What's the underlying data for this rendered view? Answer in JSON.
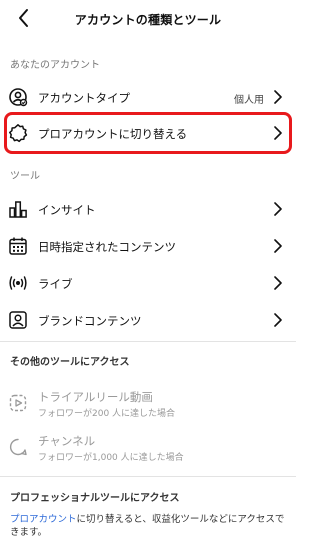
{
  "header": {
    "title": "アカウントの種類とツール",
    "back_icon": "chevron-left-icon"
  },
  "your_account": {
    "section_label": "あなたのアカウント",
    "account_type": {
      "label": "アカウントタイプ",
      "value": "個人用",
      "icon": "person-badge-icon"
    },
    "switch_pro": {
      "label": "プロアカウントに切り替える",
      "icon": "gear-badge-icon",
      "highlight_color": "#e8191c"
    }
  },
  "tools": {
    "section_label": "ツール",
    "items": [
      {
        "label": "インサイト",
        "icon": "bar-chart-icon"
      },
      {
        "label": "日時指定されたコンテンツ",
        "icon": "calendar-icon"
      },
      {
        "label": "ライブ",
        "icon": "live-broadcast-icon"
      },
      {
        "label": "ブランドコンテンツ",
        "icon": "branded-content-icon"
      }
    ]
  },
  "other_tools": {
    "section_label": "その他のツールにアクセス",
    "items": [
      {
        "label": "トライアルリール動画",
        "sub": "フォロワーが200 人に達した場合",
        "icon": "trial-reel-icon"
      },
      {
        "label": "チャンネル",
        "sub": "フォロワーが1,000 人に達した場合",
        "icon": "channel-icon"
      }
    ]
  },
  "professional": {
    "section_label": "プロフェッショナルツールにアクセス",
    "link_text": "プロアカウント",
    "body_text": "に切り替えると、収益化ツールなどにアクセスできます。",
    "link_color": "#2f6bd8"
  }
}
